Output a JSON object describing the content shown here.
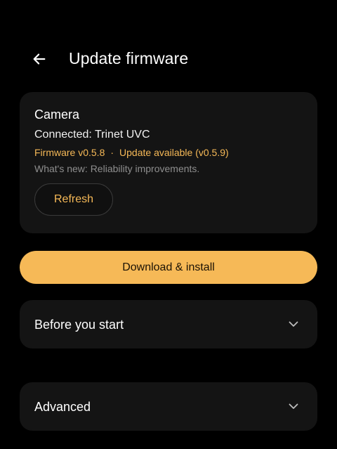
{
  "header": {
    "title": "Update firmware",
    "back_icon": "arrow-left-icon"
  },
  "device_card": {
    "title": "Camera",
    "connected": "Connected: Trinet UVC",
    "firmware_current": "Firmware v0.5.8",
    "separator": "·",
    "update_status": "Update available (v0.5.9)",
    "whats_new": "What's new: Reliability improvements.",
    "refresh_label": "Refresh"
  },
  "primary_action": {
    "label": "Download & install"
  },
  "sections": [
    {
      "label": "Before you start",
      "icon": "chevron-down-icon"
    },
    {
      "label": "Advanced",
      "icon": "chevron-down-icon"
    }
  ],
  "colors": {
    "background": "#000000",
    "card": "#141414",
    "accent": "#f6b957",
    "text_primary": "#ffffff",
    "text_secondary": "#8e8e8e"
  }
}
